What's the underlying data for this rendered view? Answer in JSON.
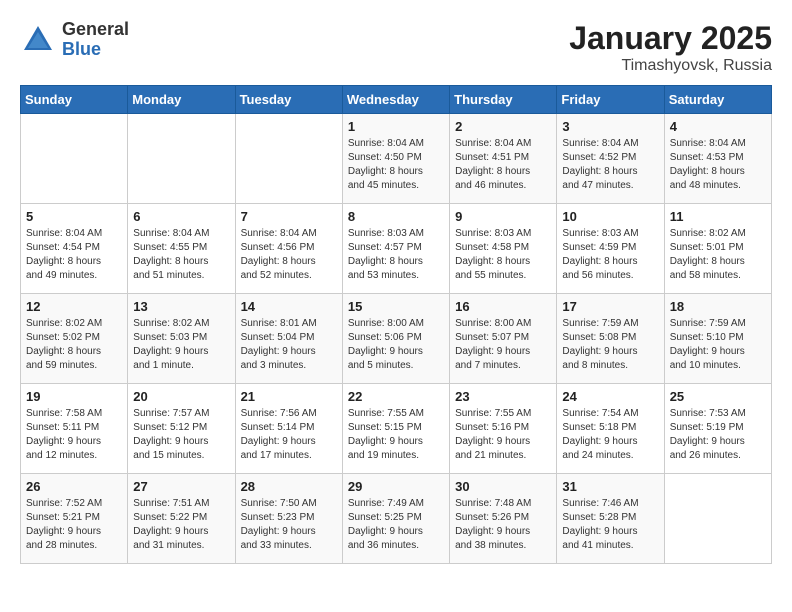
{
  "logo": {
    "general": "General",
    "blue": "Blue"
  },
  "title": "January 2025",
  "subtitle": "Timashyovsk, Russia",
  "days_header": [
    "Sunday",
    "Monday",
    "Tuesday",
    "Wednesday",
    "Thursday",
    "Friday",
    "Saturday"
  ],
  "weeks": [
    [
      {
        "day": "",
        "info": ""
      },
      {
        "day": "",
        "info": ""
      },
      {
        "day": "",
        "info": ""
      },
      {
        "day": "1",
        "info": "Sunrise: 8:04 AM\nSunset: 4:50 PM\nDaylight: 8 hours\nand 45 minutes."
      },
      {
        "day": "2",
        "info": "Sunrise: 8:04 AM\nSunset: 4:51 PM\nDaylight: 8 hours\nand 46 minutes."
      },
      {
        "day": "3",
        "info": "Sunrise: 8:04 AM\nSunset: 4:52 PM\nDaylight: 8 hours\nand 47 minutes."
      },
      {
        "day": "4",
        "info": "Sunrise: 8:04 AM\nSunset: 4:53 PM\nDaylight: 8 hours\nand 48 minutes."
      }
    ],
    [
      {
        "day": "5",
        "info": "Sunrise: 8:04 AM\nSunset: 4:54 PM\nDaylight: 8 hours\nand 49 minutes."
      },
      {
        "day": "6",
        "info": "Sunrise: 8:04 AM\nSunset: 4:55 PM\nDaylight: 8 hours\nand 51 minutes."
      },
      {
        "day": "7",
        "info": "Sunrise: 8:04 AM\nSunset: 4:56 PM\nDaylight: 8 hours\nand 52 minutes."
      },
      {
        "day": "8",
        "info": "Sunrise: 8:03 AM\nSunset: 4:57 PM\nDaylight: 8 hours\nand 53 minutes."
      },
      {
        "day": "9",
        "info": "Sunrise: 8:03 AM\nSunset: 4:58 PM\nDaylight: 8 hours\nand 55 minutes."
      },
      {
        "day": "10",
        "info": "Sunrise: 8:03 AM\nSunset: 4:59 PM\nDaylight: 8 hours\nand 56 minutes."
      },
      {
        "day": "11",
        "info": "Sunrise: 8:02 AM\nSunset: 5:01 PM\nDaylight: 8 hours\nand 58 minutes."
      }
    ],
    [
      {
        "day": "12",
        "info": "Sunrise: 8:02 AM\nSunset: 5:02 PM\nDaylight: 8 hours\nand 59 minutes."
      },
      {
        "day": "13",
        "info": "Sunrise: 8:02 AM\nSunset: 5:03 PM\nDaylight: 9 hours\nand 1 minute."
      },
      {
        "day": "14",
        "info": "Sunrise: 8:01 AM\nSunset: 5:04 PM\nDaylight: 9 hours\nand 3 minutes."
      },
      {
        "day": "15",
        "info": "Sunrise: 8:00 AM\nSunset: 5:06 PM\nDaylight: 9 hours\nand 5 minutes."
      },
      {
        "day": "16",
        "info": "Sunrise: 8:00 AM\nSunset: 5:07 PM\nDaylight: 9 hours\nand 7 minutes."
      },
      {
        "day": "17",
        "info": "Sunrise: 7:59 AM\nSunset: 5:08 PM\nDaylight: 9 hours\nand 8 minutes."
      },
      {
        "day": "18",
        "info": "Sunrise: 7:59 AM\nSunset: 5:10 PM\nDaylight: 9 hours\nand 10 minutes."
      }
    ],
    [
      {
        "day": "19",
        "info": "Sunrise: 7:58 AM\nSunset: 5:11 PM\nDaylight: 9 hours\nand 12 minutes."
      },
      {
        "day": "20",
        "info": "Sunrise: 7:57 AM\nSunset: 5:12 PM\nDaylight: 9 hours\nand 15 minutes."
      },
      {
        "day": "21",
        "info": "Sunrise: 7:56 AM\nSunset: 5:14 PM\nDaylight: 9 hours\nand 17 minutes."
      },
      {
        "day": "22",
        "info": "Sunrise: 7:55 AM\nSunset: 5:15 PM\nDaylight: 9 hours\nand 19 minutes."
      },
      {
        "day": "23",
        "info": "Sunrise: 7:55 AM\nSunset: 5:16 PM\nDaylight: 9 hours\nand 21 minutes."
      },
      {
        "day": "24",
        "info": "Sunrise: 7:54 AM\nSunset: 5:18 PM\nDaylight: 9 hours\nand 24 minutes."
      },
      {
        "day": "25",
        "info": "Sunrise: 7:53 AM\nSunset: 5:19 PM\nDaylight: 9 hours\nand 26 minutes."
      }
    ],
    [
      {
        "day": "26",
        "info": "Sunrise: 7:52 AM\nSunset: 5:21 PM\nDaylight: 9 hours\nand 28 minutes."
      },
      {
        "day": "27",
        "info": "Sunrise: 7:51 AM\nSunset: 5:22 PM\nDaylight: 9 hours\nand 31 minutes."
      },
      {
        "day": "28",
        "info": "Sunrise: 7:50 AM\nSunset: 5:23 PM\nDaylight: 9 hours\nand 33 minutes."
      },
      {
        "day": "29",
        "info": "Sunrise: 7:49 AM\nSunset: 5:25 PM\nDaylight: 9 hours\nand 36 minutes."
      },
      {
        "day": "30",
        "info": "Sunrise: 7:48 AM\nSunset: 5:26 PM\nDaylight: 9 hours\nand 38 minutes."
      },
      {
        "day": "31",
        "info": "Sunrise: 7:46 AM\nSunset: 5:28 PM\nDaylight: 9 hours\nand 41 minutes."
      },
      {
        "day": "",
        "info": ""
      }
    ]
  ]
}
